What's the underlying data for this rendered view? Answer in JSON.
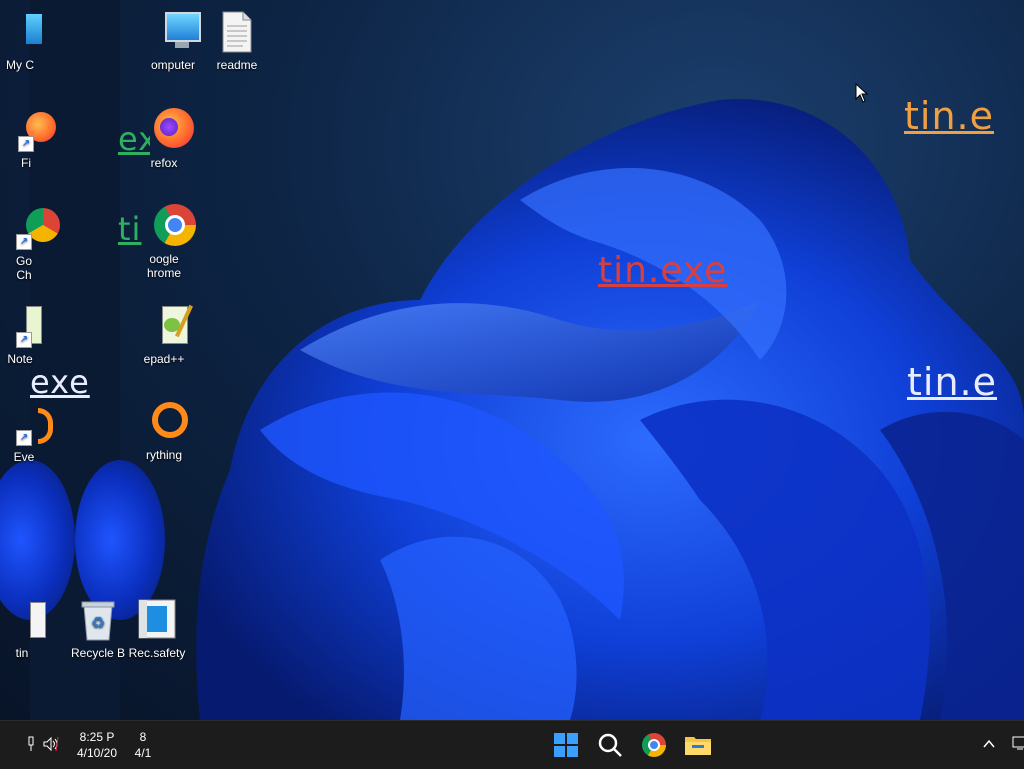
{
  "desktop": {
    "icons": [
      {
        "id": "my-computer-left",
        "label": "My C"
      },
      {
        "id": "computer",
        "label": "omputer"
      },
      {
        "id": "readme",
        "label": "readme"
      },
      {
        "id": "firefox-left",
        "label": "Fi"
      },
      {
        "id": "firefox",
        "label": "refox"
      },
      {
        "id": "chrome-left",
        "label": "Go\nCh"
      },
      {
        "id": "chrome",
        "label": "oogle\nhrome"
      },
      {
        "id": "notepad-left",
        "label": "Note"
      },
      {
        "id": "notepad",
        "label": "epad++"
      },
      {
        "id": "everything-left",
        "label": "Eve"
      },
      {
        "id": "everything",
        "label": "rything"
      },
      {
        "id": "tin-left",
        "label": "tin"
      },
      {
        "id": "recycle",
        "label": "Recycle B"
      },
      {
        "id": "recsafety",
        "label": "Rec.safety"
      }
    ],
    "watermarks": {
      "top_right": "tin.e",
      "center": "tin.exe",
      "right": "tin.e",
      "left": "exe",
      "green1": "ex",
      "green2": "ti"
    }
  },
  "taskbar": {
    "tray_time": "8:25 P",
    "tray_date": "4/10/20",
    "tray_time2": "8",
    "tray_date2": "4/1",
    "apps": [
      "start-icon",
      "search-icon",
      "chrome-icon",
      "file-explorer-icon"
    ]
  },
  "colors": {
    "accent": "#1a5fff",
    "taskbar": "#1c1c1c",
    "wm_orange": "#f0a040",
    "wm_red": "#d84040",
    "wm_white": "#e8ecff",
    "wm_green": "#2fb060"
  }
}
